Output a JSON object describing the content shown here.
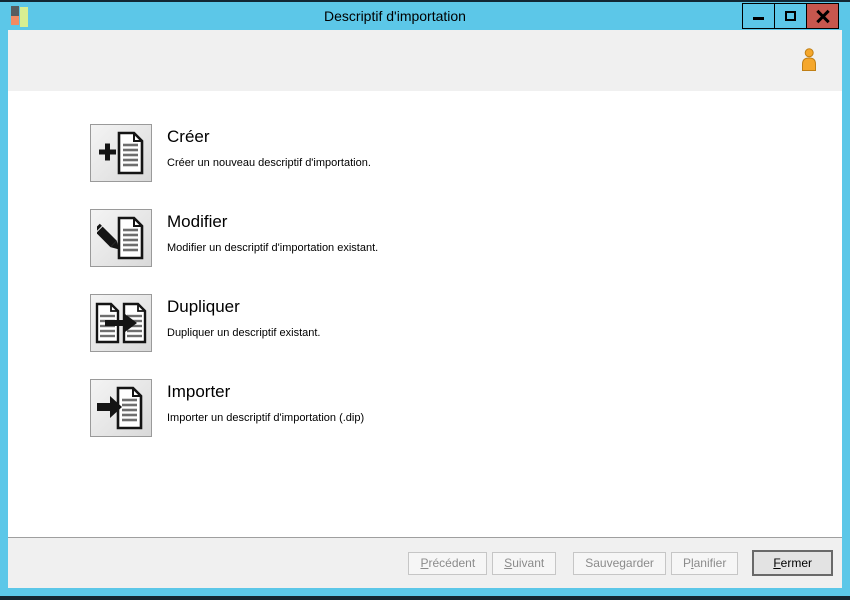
{
  "window": {
    "title": "Descriptif d'importation"
  },
  "icons": {
    "app_logo": "app-logo-icon",
    "minimize": "minimize-icon",
    "maximize": "maximize-icon",
    "close": "close-icon",
    "user": "user-icon",
    "create": "plus-document-icon",
    "edit": "pencil-document-icon",
    "duplicate": "duplicate-document-icon",
    "import": "import-arrow-document-icon"
  },
  "actions": [
    {
      "title": "Créer",
      "description": "Créer un nouveau descriptif d'importation."
    },
    {
      "title": "Modifier",
      "description": "Modifier un descriptif d'importation existant."
    },
    {
      "title": "Dupliquer",
      "description": "Dupliquer un descriptif existant."
    },
    {
      "title": "Importer",
      "description": "Importer un descriptif d'importation (.dip)"
    }
  ],
  "footer": {
    "buttons": [
      {
        "pre": "",
        "key": "P",
        "post": "récédent",
        "enabled": false
      },
      {
        "pre": "",
        "key": "S",
        "post": "uivant",
        "enabled": false
      },
      {
        "pre": "Sauvegarder",
        "key": "",
        "post": "",
        "enabled": false
      },
      {
        "pre": "P",
        "key": "l",
        "post": "anifier",
        "enabled": false
      },
      {
        "pre": "",
        "key": "F",
        "post": "ermer",
        "enabled": true,
        "default": true
      }
    ]
  },
  "colors": {
    "titlebar": "#5CC7E8",
    "close_button": "#C7574E",
    "band": "#F0F0F0",
    "content": "#FFFFFF",
    "user_icon": "#F5A72B",
    "disabled_text": "#8B8B8B",
    "logo_gray": "#575D60",
    "logo_orange": "#F28B63",
    "logo_green": "#D8EF91"
  }
}
